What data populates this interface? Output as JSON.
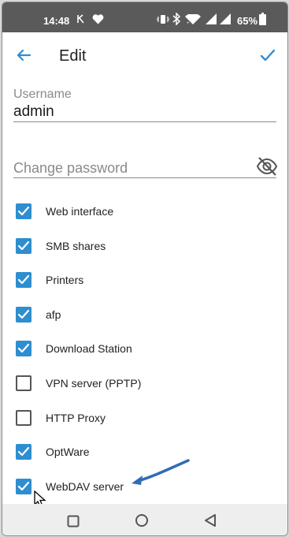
{
  "status_bar": {
    "time": "14:48",
    "battery": "65%",
    "icons": [
      "k-icon",
      "heart-icon",
      "vibrate-icon",
      "bluetooth-icon",
      "wifi-icon",
      "signal-icon",
      "signal-icon",
      "battery-icon"
    ]
  },
  "app_bar": {
    "title": "Edit",
    "back_icon": "arrow-left-icon",
    "confirm_icon": "check-icon"
  },
  "form": {
    "username_label": "Username",
    "username_value": "admin",
    "password_placeholder": "Change password",
    "visibility_icon": "eye-off-icon"
  },
  "permissions": [
    {
      "label": "Web interface",
      "checked": true
    },
    {
      "label": "SMB shares",
      "checked": true
    },
    {
      "label": "Printers",
      "checked": true
    },
    {
      "label": "afp",
      "checked": true
    },
    {
      "label": "Download Station",
      "checked": true
    },
    {
      "label": "VPN server (PPTP)",
      "checked": false
    },
    {
      "label": "HTTP Proxy",
      "checked": false
    },
    {
      "label": "OptWare",
      "checked": true
    },
    {
      "label": "WebDAV server",
      "checked": true
    }
  ],
  "nav_bar": {
    "icons": [
      "square-icon",
      "circle-icon",
      "triangle-back-icon"
    ]
  },
  "colors": {
    "accent": "#2e8ecf",
    "status_bar": "#5a5a5a",
    "annotation_arrow": "#2f6db3"
  }
}
